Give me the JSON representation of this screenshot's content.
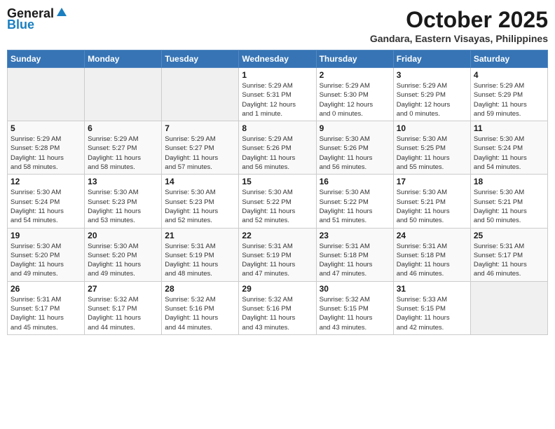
{
  "header": {
    "logo_line1": "General",
    "logo_line2": "Blue",
    "month": "October 2025",
    "location": "Gandara, Eastern Visayas, Philippines"
  },
  "days_of_week": [
    "Sunday",
    "Monday",
    "Tuesday",
    "Wednesday",
    "Thursday",
    "Friday",
    "Saturday"
  ],
  "weeks": [
    [
      {
        "day": "",
        "info": ""
      },
      {
        "day": "",
        "info": ""
      },
      {
        "day": "",
        "info": ""
      },
      {
        "day": "1",
        "info": "Sunrise: 5:29 AM\nSunset: 5:31 PM\nDaylight: 12 hours\nand 1 minute."
      },
      {
        "day": "2",
        "info": "Sunrise: 5:29 AM\nSunset: 5:30 PM\nDaylight: 12 hours\nand 0 minutes."
      },
      {
        "day": "3",
        "info": "Sunrise: 5:29 AM\nSunset: 5:29 PM\nDaylight: 12 hours\nand 0 minutes."
      },
      {
        "day": "4",
        "info": "Sunrise: 5:29 AM\nSunset: 5:29 PM\nDaylight: 11 hours\nand 59 minutes."
      }
    ],
    [
      {
        "day": "5",
        "info": "Sunrise: 5:29 AM\nSunset: 5:28 PM\nDaylight: 11 hours\nand 58 minutes."
      },
      {
        "day": "6",
        "info": "Sunrise: 5:29 AM\nSunset: 5:27 PM\nDaylight: 11 hours\nand 58 minutes."
      },
      {
        "day": "7",
        "info": "Sunrise: 5:29 AM\nSunset: 5:27 PM\nDaylight: 11 hours\nand 57 minutes."
      },
      {
        "day": "8",
        "info": "Sunrise: 5:29 AM\nSunset: 5:26 PM\nDaylight: 11 hours\nand 56 minutes."
      },
      {
        "day": "9",
        "info": "Sunrise: 5:30 AM\nSunset: 5:26 PM\nDaylight: 11 hours\nand 56 minutes."
      },
      {
        "day": "10",
        "info": "Sunrise: 5:30 AM\nSunset: 5:25 PM\nDaylight: 11 hours\nand 55 minutes."
      },
      {
        "day": "11",
        "info": "Sunrise: 5:30 AM\nSunset: 5:24 PM\nDaylight: 11 hours\nand 54 minutes."
      }
    ],
    [
      {
        "day": "12",
        "info": "Sunrise: 5:30 AM\nSunset: 5:24 PM\nDaylight: 11 hours\nand 54 minutes."
      },
      {
        "day": "13",
        "info": "Sunrise: 5:30 AM\nSunset: 5:23 PM\nDaylight: 11 hours\nand 53 minutes."
      },
      {
        "day": "14",
        "info": "Sunrise: 5:30 AM\nSunset: 5:23 PM\nDaylight: 11 hours\nand 52 minutes."
      },
      {
        "day": "15",
        "info": "Sunrise: 5:30 AM\nSunset: 5:22 PM\nDaylight: 11 hours\nand 52 minutes."
      },
      {
        "day": "16",
        "info": "Sunrise: 5:30 AM\nSunset: 5:22 PM\nDaylight: 11 hours\nand 51 minutes."
      },
      {
        "day": "17",
        "info": "Sunrise: 5:30 AM\nSunset: 5:21 PM\nDaylight: 11 hours\nand 50 minutes."
      },
      {
        "day": "18",
        "info": "Sunrise: 5:30 AM\nSunset: 5:21 PM\nDaylight: 11 hours\nand 50 minutes."
      }
    ],
    [
      {
        "day": "19",
        "info": "Sunrise: 5:30 AM\nSunset: 5:20 PM\nDaylight: 11 hours\nand 49 minutes."
      },
      {
        "day": "20",
        "info": "Sunrise: 5:30 AM\nSunset: 5:20 PM\nDaylight: 11 hours\nand 49 minutes."
      },
      {
        "day": "21",
        "info": "Sunrise: 5:31 AM\nSunset: 5:19 PM\nDaylight: 11 hours\nand 48 minutes."
      },
      {
        "day": "22",
        "info": "Sunrise: 5:31 AM\nSunset: 5:19 PM\nDaylight: 11 hours\nand 47 minutes."
      },
      {
        "day": "23",
        "info": "Sunrise: 5:31 AM\nSunset: 5:18 PM\nDaylight: 11 hours\nand 47 minutes."
      },
      {
        "day": "24",
        "info": "Sunrise: 5:31 AM\nSunset: 5:18 PM\nDaylight: 11 hours\nand 46 minutes."
      },
      {
        "day": "25",
        "info": "Sunrise: 5:31 AM\nSunset: 5:17 PM\nDaylight: 11 hours\nand 46 minutes."
      }
    ],
    [
      {
        "day": "26",
        "info": "Sunrise: 5:31 AM\nSunset: 5:17 PM\nDaylight: 11 hours\nand 45 minutes."
      },
      {
        "day": "27",
        "info": "Sunrise: 5:32 AM\nSunset: 5:17 PM\nDaylight: 11 hours\nand 44 minutes."
      },
      {
        "day": "28",
        "info": "Sunrise: 5:32 AM\nSunset: 5:16 PM\nDaylight: 11 hours\nand 44 minutes."
      },
      {
        "day": "29",
        "info": "Sunrise: 5:32 AM\nSunset: 5:16 PM\nDaylight: 11 hours\nand 43 minutes."
      },
      {
        "day": "30",
        "info": "Sunrise: 5:32 AM\nSunset: 5:15 PM\nDaylight: 11 hours\nand 43 minutes."
      },
      {
        "day": "31",
        "info": "Sunrise: 5:33 AM\nSunset: 5:15 PM\nDaylight: 11 hours\nand 42 minutes."
      },
      {
        "day": "",
        "info": ""
      }
    ]
  ]
}
